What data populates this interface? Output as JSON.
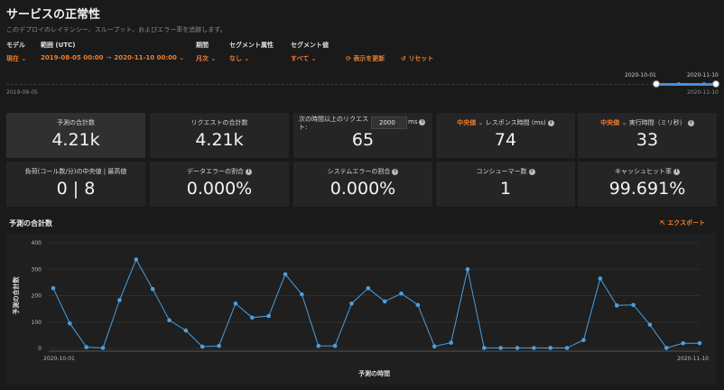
{
  "page": {
    "title": "サービスの正常性",
    "subtitle": "このデプロイのレイテンシー、スループット、およびエラー率を追跡します。"
  },
  "filters": {
    "model_label": "モデル",
    "model_value": "現在 ⌄",
    "range_label": "範囲 (UTC)",
    "range_start": "2019-08-05 00:00",
    "range_arrow": "→",
    "range_end": "2020-11-10 00:00 ⌄",
    "period_label": "期間",
    "period_value": "月次 ⌄",
    "segment_attr_label": "セグメント属性",
    "segment_attr_value": "なし ⌄",
    "segment_value_label": "セグメント値",
    "segment_value_value": "すべて ⌄",
    "refresh_label": "表示を更新",
    "reset_label": "リセット"
  },
  "timeline": {
    "start_label": "2019-08-05",
    "end_label": "2020-11-10",
    "sel_start_label": "2020-10-01",
    "sel_end_label": "2020-11-10"
  },
  "metrics": [
    {
      "label": "予測の合計数",
      "value": "4.21k"
    },
    {
      "label": "リクエストの合計数",
      "value": "4.21k"
    },
    {
      "label": "次の時間以上のリクエスト:",
      "value": "65",
      "unit": "ms",
      "threshold": "2000"
    },
    {
      "prefix": "中央値 ⌄",
      "label": "レスポンス時間 (ms)",
      "value": "74"
    },
    {
      "prefix": "中央値 ⌄",
      "label": "実行時間（ミリ秒）",
      "value": "33"
    },
    {
      "label": "負荷(コール数/分)の中央値 | 最高値",
      "value": "0 | 8"
    },
    {
      "label": "データエラーの割合",
      "value": "0.000%"
    },
    {
      "label": "システムエラーの割合",
      "value": "0.000%"
    },
    {
      "label": "コンシューマー数",
      "value": "1"
    },
    {
      "label": "キャッシュヒット率",
      "value": "99.691%"
    }
  ],
  "chart_section": {
    "title": "予測の合計数",
    "export_label": "エクスポート"
  },
  "colors": {
    "accent": "#f07d2b",
    "series": "#4a9fe0",
    "background": "#1a1a1a",
    "card": "#252525"
  },
  "chart_data": {
    "type": "line",
    "xlabel": "予測の時間",
    "ylabel": "予測の合計数",
    "ylim": [
      0,
      400
    ],
    "yticks": [
      0,
      100,
      200,
      300,
      400
    ],
    "x_start_label": "2020-10-01",
    "x_end_label": "2020-11-10",
    "grid": true,
    "series": [
      {
        "values": [
          228,
          95,
          5,
          2,
          183,
          337,
          225,
          107,
          68,
          7,
          10,
          170,
          117,
          123,
          281,
          205,
          10,
          10,
          170,
          228,
          178,
          208,
          165,
          8,
          22,
          300,
          2,
          2,
          2,
          2,
          2,
          2,
          32,
          265,
          163,
          165,
          90,
          2,
          20,
          20
        ]
      }
    ]
  }
}
